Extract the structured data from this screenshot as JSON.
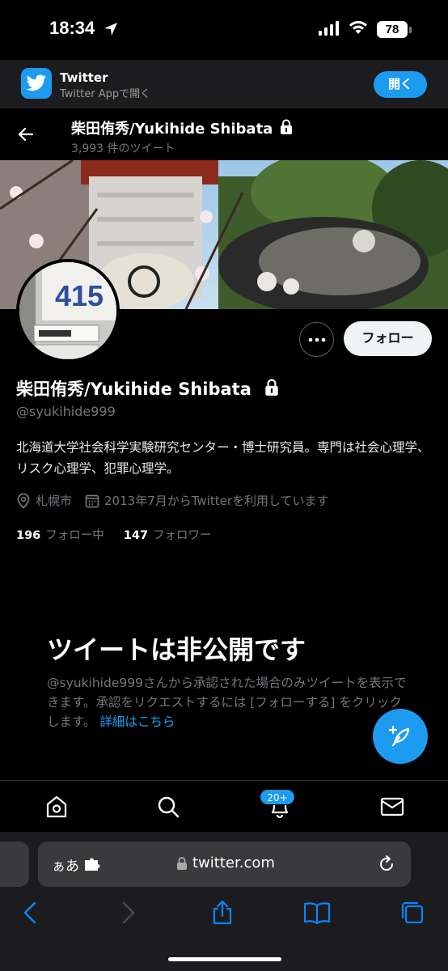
{
  "status_bar": {
    "time": "18:34",
    "battery": "78"
  },
  "banner": {
    "app_name": "Twitter",
    "subtitle": "Twitter Appで開く",
    "open_label": "開く"
  },
  "header": {
    "name": "柴田侑秀/Yukihide Shibata",
    "tweet_count": "3,993 件のツイート"
  },
  "profile": {
    "name": "柴田侑秀/Yukihide Shibata",
    "handle": "@syukihide999",
    "bio": "北海道大学社会科学実験研究センター・博士研究員。専門は社会心理学、リスク心理学、犯罪心理学。",
    "location": "札幌市",
    "joined": "2013年7月からTwitterを利用しています",
    "following_count": "196",
    "following_label": "フォロー中",
    "followers_count": "147",
    "followers_label": "フォロワー",
    "follow_button": "フォロー",
    "avatar_label": "415"
  },
  "private": {
    "title": "ツイートは非公開です",
    "description": "@syukihide999さんから承認された場合のみツイートを表示できます。承認をリクエストするには [フォローする] をクリックします。",
    "link": "詳細はこちら"
  },
  "tab_bar": {
    "notification_badge": "20+",
    "items": [
      "home-icon",
      "search-icon",
      "bell-icon",
      "mail-icon"
    ]
  },
  "browser": {
    "aa": "ぁあ",
    "url": "twitter.com"
  },
  "colors": {
    "accent": "#1d9bf0",
    "background": "#000000",
    "muted": "#71767b"
  }
}
